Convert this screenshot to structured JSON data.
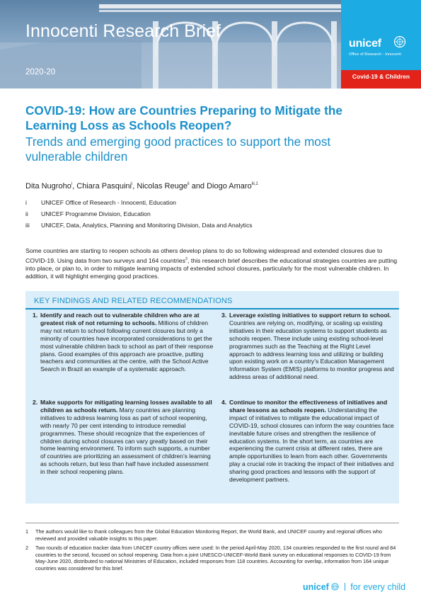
{
  "header": {
    "title": "Innocenti Research Brief",
    "year": "2020-20",
    "logo_text": "unicef",
    "logo_subtitle": "Office of Research - Innocenti",
    "tag": "Covid-19 & Children",
    "colors": {
      "unicef_blue": "#1cabe2",
      "tag_red": "#e2231a",
      "title_blue": "#1a8fc9"
    }
  },
  "title": {
    "main": "COVID-19: How are Countries Preparing to Mitigate the Learning Loss as Schools Reopen?",
    "subtitle": "Trends and emerging good practices to support the most vulnerable children"
  },
  "authors": [
    {
      "name": "Dita Nugroho",
      "sup": "i"
    },
    {
      "name": "Chiara Pasquini",
      "sup": "i"
    },
    {
      "name": "Nicolas Reuge",
      "sup": "ii"
    },
    {
      "name": "Diogo Amaro",
      "sup": "iii,1"
    }
  ],
  "author_connectors": {
    "comma": ", ",
    "and": " and "
  },
  "affiliations": [
    {
      "num": "i",
      "text": "UNICEF Office of Research - Innocenti, Education"
    },
    {
      "num": "ii",
      "text": "UNICEF Programme Division, Education"
    },
    {
      "num": "iii",
      "text": "UNICEF, Data, Analytics, Planning and Monitoring Division, Data and Analytics"
    }
  ],
  "intro": {
    "before_sup": "Some countries are starting to reopen schools as others develop plans to do so following widespread and extended closures due to COVID-19. Using data from two surveys and 164 countries",
    "sup": "2",
    "after_sup": ", this research brief describes the educational strategies countries are putting into place, or plan to, in order to mitigate learning impacts of extended school closures, particularly for the most vulnerable children. In addition, it will highlight emerging good practices."
  },
  "key_findings": {
    "heading": "KEY FINDINGS AND RELATED RECOMMENDATIONS",
    "items": [
      {
        "num": "1.",
        "bold": "Identify and reach out to vulnerable children who are at greatest risk of not returning to schools.",
        "text": " Millions of children may not return to school following current closures but only a minority of countries have incorporated considerations to get the most vulnerable children back to school as part of their response plans. Good examples of this approach are proactive, putting teachers and communities at the centre, with the School Active Search in Brazil an example of a systematic approach."
      },
      {
        "num": "2.",
        "bold": "Make supports for mitigating learning losses available to all children as schools return.",
        "text": " Many countries are planning initiatives to address learning loss as part of school reopening, with nearly 70 per cent intending to introduce remedial programmes. These should recognize that the experiences of children during school closures can vary greatly based on their home learning environment. To inform such supports, a number of countries are prioritizing an assessment of children’s learning as schools return, but less than half have included assessment in their school reopening plans."
      },
      {
        "num": "3.",
        "bold": "Leverage existing initiatives to support return to school.",
        "text": " Countries are relying on, modifying, or scaling up existing initiatives in their education systems to support students as schools reopen. These include using existing school-level programmes such as the Teaching at the Right Level approach to address learning loss and utilizing or building upon existing work on a country’s Education Management Information System (EMIS) platforms to monitor progress and address areas of additional need."
      },
      {
        "num": "4.",
        "bold": "Continue to monitor the effectiveness of initiatives and share lessons as schools reopen.",
        "text": " Understanding the impact of initiatives to mitigate the educational impact of COVID-19, school closures can inform the way countries face inevitable future crises and strengthen the resilience of education systems. In the short term, as countries are experiencing the current crisis at different rates, there are ample opportunities to learn from each other. Governments play a crucial role in tracking the impact of their initiatives and sharing good practices and lessons with the support of development partners."
      }
    ]
  },
  "footnotes": [
    {
      "num": "1",
      "text": "The authors would like to thank colleagues from the Global Education Monitoring Report, the World Bank, and UNICEF country and regional offices who reviewed and provided valuable insights to this paper."
    },
    {
      "num": "2",
      "text": "Two rounds of education tracker data from UNICEF country offices were used: In the period April-May 2020, 134 countries responded to the first round and 84 countries to the second, focused on school reopening. Data from a joint UNESCO-UNICEF-World Bank survey on educational responses to COVID-19 from May-June 2020, distributed to national Ministries of Education, included responses from 118 countries. Accounting for overlap, information from 164 unique countries was considered for this brief."
    }
  ],
  "footer": {
    "logo": "unicef",
    "tagline": "for every child"
  }
}
